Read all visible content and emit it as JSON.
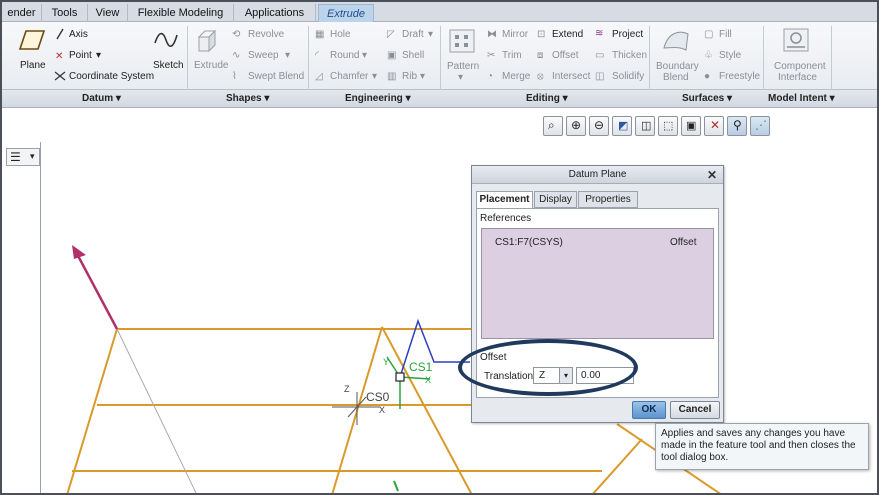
{
  "ribbon_tabs": [
    "ender",
    "Tools",
    "View",
    "Flexible Modeling",
    "Applications",
    "Extrude"
  ],
  "datum": {
    "plane": "Plane",
    "axis": "Axis",
    "point": "Point",
    "coordinate_system": "Coordinate System",
    "sketch": "Sketch"
  },
  "shapes": {
    "extrude": "Extrude",
    "revolve": "Revolve",
    "sweep": "Sweep",
    "swept_blend": "Swept Blend"
  },
  "engineering": {
    "hole": "Hole",
    "draft": "Draft",
    "round": "Round",
    "shell": "Shell",
    "chamfer": "Chamfer",
    "rib": "Rib"
  },
  "editing": {
    "pattern": "Pattern",
    "mirror": "Mirror",
    "extend": "Extend",
    "project": "Project",
    "trim": "Trim",
    "offset": "Offset",
    "thicken": "Thicken",
    "merge": "Merge",
    "intersect": "Intersect",
    "solidify": "Solidify"
  },
  "surfaces": {
    "boundary_blend_1": "Boundary",
    "boundary_blend_2": "Blend",
    "fill": "Fill",
    "style": "Style",
    "freestyle": "Freestyle"
  },
  "model_intent": {
    "component_interface_1": "Component",
    "component_interface_2": "Interface"
  },
  "group_labels": {
    "datum": "Datum",
    "shapes": "Shapes",
    "engineering": "Engineering",
    "editing": "Editing",
    "surfaces": "Surfaces",
    "model_intent": "Model Intent"
  },
  "dialog": {
    "title": "Datum Plane",
    "close": "✕",
    "tabs": [
      "Placement",
      "Display",
      "Properties"
    ],
    "references_label": "References",
    "reference_row": {
      "name": "CS1:F7(CSYS)",
      "type": "Offset"
    },
    "offset_label": "Offset",
    "translation_label": "Translation",
    "translation_axis": "Z",
    "translation_value": "0.00",
    "ok": "OK",
    "cancel": "Cancel"
  },
  "tooltip": "Applies and saves any changes you have made in the feature tool and then closes the tool dialog box.",
  "scene_labels": {
    "cs0": "CS0",
    "cs1": "CS1",
    "x": "X",
    "y": "Y",
    "z": "Z"
  },
  "colors": {
    "accent_tab": "#1f4e8c",
    "reference_bg": "#dccfe2",
    "edge_orange": "#d99a2b",
    "arrow_magenta": "#b0306a",
    "csys_green": "#2aa33a",
    "csys_blue": "#2e3fbf",
    "highlight_oval": "#203a5e"
  }
}
